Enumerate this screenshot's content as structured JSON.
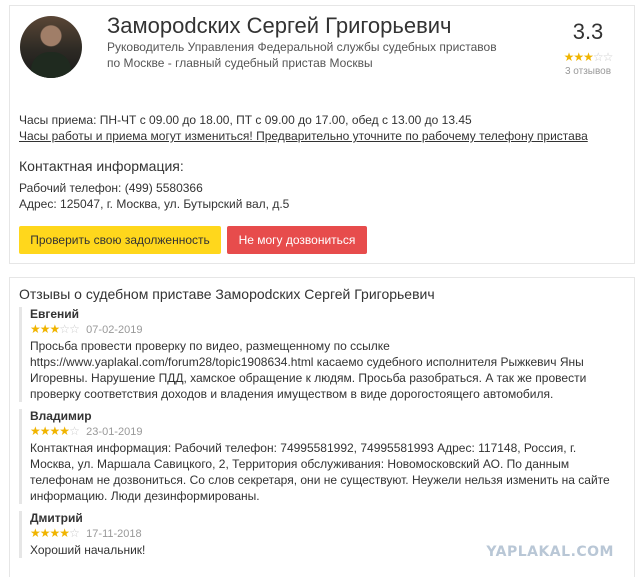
{
  "profile": {
    "name": "Заморodских Сергей Григорьевич",
    "position": "Руководитель Управления Федеральной службы судебных приставов по Москве - главный судебный пристав Москвы",
    "rating": "3.3",
    "rating_stars": 3,
    "rating_count": "3 отзывов",
    "hours": "Часы приема: ПН-ЧТ с 09.00 до 18.00, ПТ с 09.00 до 17.00, обед с 13.00 до 13.45",
    "hours_note": "Часы работы и приема могут измениться! Предварительно уточните по рабочему телефону пристава",
    "contact_title": "Контактная информация:",
    "phone": "Рабочий телефон: (499) 5580366",
    "address": "Адрес: 125047, г. Москва, ул. Бутырский вал, д.5",
    "buttons": {
      "check_debt": "Проверить свою задолженность",
      "cannot_call": "Не могу дозвониться"
    }
  },
  "reviews": {
    "title": "Отзывы о судебном приставе Заморodских Сергей Григорьевич",
    "items": [
      {
        "author": "Евгений",
        "stars": 3,
        "date": "07-02-2019",
        "text": "Просьба провести проверку по видео, размещенному по ссылке https://www.yaplakal.com/forum28/topic1908634.html касаемо судебного исполнителя Рыжкевич Яны Игоревны. Нарушение ПДД, хамское обращение к людям. Просьба разобраться. А так же провести проверку соответствия доходов и владения имуществом в виде дорогостоящего автомобиля."
      },
      {
        "author": "Владимир",
        "stars": 4,
        "date": "23-01-2019",
        "text": "Контактная информация: Рабочий телефон: 74995581992, 74995581993 Адрес: 117148, Россия, г. Москва, ул. Маршала Савицкого, 2, Территория обслуживания: Новомосковский АО. По данным телефонам не дозвониться. Со слов секретаря, они не существуют. Неужели нельзя изменить на сайте информацию. Люди дезинформированы."
      },
      {
        "author": "Дмитрий",
        "stars": 4,
        "date": "17-11-2018",
        "text": "Хороший начальник!"
      }
    ]
  },
  "watermark": "YAPLAKAL.COM",
  "colors": {
    "star": "#f0b400",
    "yellow_button": "#ffd71c",
    "red_button": "#e74c4c"
  }
}
